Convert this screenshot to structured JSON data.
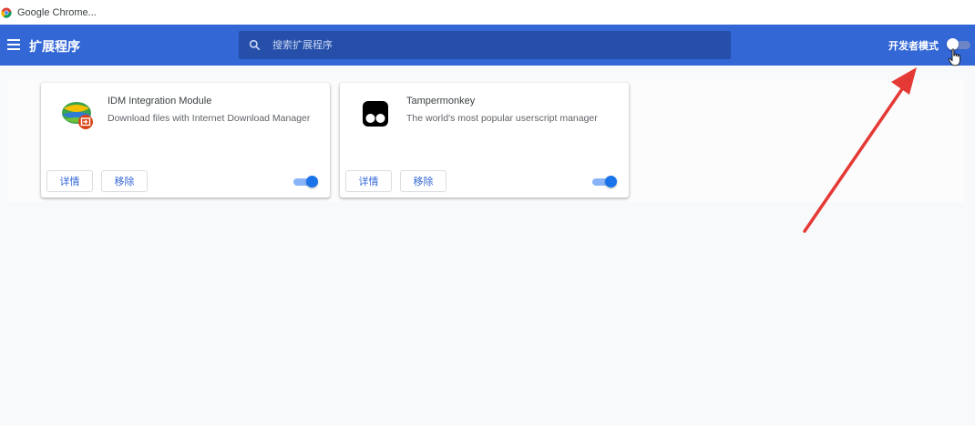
{
  "window": {
    "title": "Google Chrome..."
  },
  "toolbar": {
    "title": "扩展程序",
    "search_placeholder": "搜索扩展程序",
    "developer_mode_label": "开发者模式",
    "developer_mode_on": false
  },
  "extensions": [
    {
      "name": "IDM Integration Module",
      "description": "Download files with Internet Download Manager",
      "details_label": "详情",
      "remove_label": "移除",
      "enabled": true,
      "icon": "idm-globe-icon"
    },
    {
      "name": "Tampermonkey",
      "description": "The world's most popular userscript manager",
      "details_label": "详情",
      "remove_label": "移除",
      "enabled": true,
      "icon": "tampermonkey-icon"
    }
  ],
  "colors": {
    "header": "#3367d6",
    "search_bg": "#254fa8",
    "accent": "#1a73e8",
    "annotation": "#e53935"
  }
}
